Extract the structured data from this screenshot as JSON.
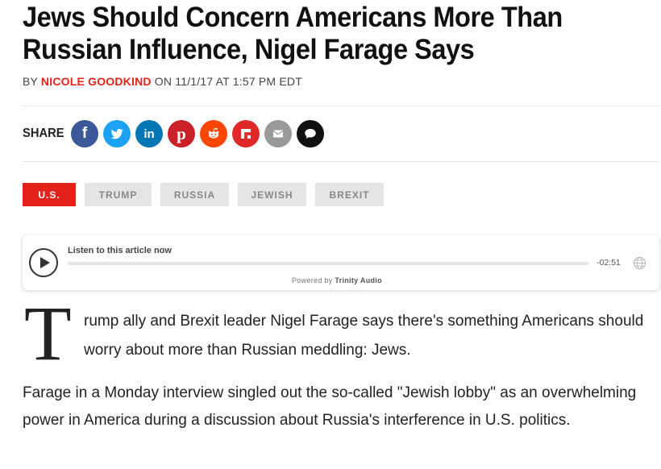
{
  "article": {
    "title": "Jews Should Concern Americans More Than Russian Influence, Nigel Farage Says",
    "byline_prefix": "BY",
    "author": "NICOLE GOODKIND",
    "date_text": "ON 11/1/17 AT 1:57 PM EDT",
    "drop_cap": "T",
    "paragraph1": "rump ally and Brexit leader Nigel Farage says there's something Americans should worry about more than Russian meddling: Jews.",
    "paragraph2": "Farage in a Monday interview singled out the so-called \"Jewish lobby\" as an overwhelming power in America during a discussion about Russia's interference in U.S. politics."
  },
  "share": {
    "label": "SHARE",
    "buttons": [
      {
        "name": "facebook",
        "icon": "facebook-icon",
        "color": "#3b5998"
      },
      {
        "name": "twitter",
        "icon": "twitter-icon",
        "color": "#1da1f2"
      },
      {
        "name": "linkedin",
        "icon": "linkedin-icon",
        "color": "#0077b5"
      },
      {
        "name": "pinterest",
        "icon": "pinterest-icon",
        "color": "#cb2027"
      },
      {
        "name": "reddit",
        "icon": "reddit-icon",
        "color": "#ff4500"
      },
      {
        "name": "flipboard",
        "icon": "flipboard-icon",
        "color": "#e12828"
      },
      {
        "name": "email",
        "icon": "email-icon",
        "color": "#999999"
      },
      {
        "name": "comment",
        "icon": "speech-bubble-icon",
        "color": "#111111"
      }
    ]
  },
  "tags": [
    {
      "label": "U.S.",
      "active": true
    },
    {
      "label": "TRUMP",
      "active": false
    },
    {
      "label": "RUSSIA",
      "active": false
    },
    {
      "label": "JEWISH",
      "active": false
    },
    {
      "label": "BREXIT",
      "active": false
    }
  ],
  "audio": {
    "listen_label": "Listen to this article now",
    "time_remaining": "-02:51",
    "powered_prefix": "Powered by",
    "powered_brand": "Trinity Audio",
    "progress": 0
  },
  "colors": {
    "accent": "#e3231b",
    "tag_bg": "#e5e5e5",
    "tag_text": "#888888"
  }
}
